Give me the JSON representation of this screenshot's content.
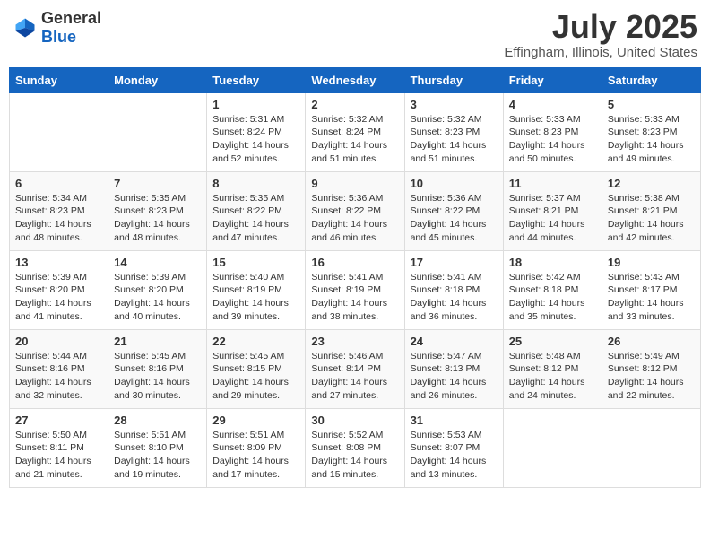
{
  "header": {
    "logo_general": "General",
    "logo_blue": "Blue",
    "month": "July 2025",
    "location": "Effingham, Illinois, United States"
  },
  "weekdays": [
    "Sunday",
    "Monday",
    "Tuesday",
    "Wednesday",
    "Thursday",
    "Friday",
    "Saturday"
  ],
  "weeks": [
    [
      {
        "day": "",
        "info": ""
      },
      {
        "day": "",
        "info": ""
      },
      {
        "day": "1",
        "info": "Sunrise: 5:31 AM\nSunset: 8:24 PM\nDaylight: 14 hours\nand 52 minutes."
      },
      {
        "day": "2",
        "info": "Sunrise: 5:32 AM\nSunset: 8:24 PM\nDaylight: 14 hours\nand 51 minutes."
      },
      {
        "day": "3",
        "info": "Sunrise: 5:32 AM\nSunset: 8:23 PM\nDaylight: 14 hours\nand 51 minutes."
      },
      {
        "day": "4",
        "info": "Sunrise: 5:33 AM\nSunset: 8:23 PM\nDaylight: 14 hours\nand 50 minutes."
      },
      {
        "day": "5",
        "info": "Sunrise: 5:33 AM\nSunset: 8:23 PM\nDaylight: 14 hours\nand 49 minutes."
      }
    ],
    [
      {
        "day": "6",
        "info": "Sunrise: 5:34 AM\nSunset: 8:23 PM\nDaylight: 14 hours\nand 48 minutes."
      },
      {
        "day": "7",
        "info": "Sunrise: 5:35 AM\nSunset: 8:23 PM\nDaylight: 14 hours\nand 48 minutes."
      },
      {
        "day": "8",
        "info": "Sunrise: 5:35 AM\nSunset: 8:22 PM\nDaylight: 14 hours\nand 47 minutes."
      },
      {
        "day": "9",
        "info": "Sunrise: 5:36 AM\nSunset: 8:22 PM\nDaylight: 14 hours\nand 46 minutes."
      },
      {
        "day": "10",
        "info": "Sunrise: 5:36 AM\nSunset: 8:22 PM\nDaylight: 14 hours\nand 45 minutes."
      },
      {
        "day": "11",
        "info": "Sunrise: 5:37 AM\nSunset: 8:21 PM\nDaylight: 14 hours\nand 44 minutes."
      },
      {
        "day": "12",
        "info": "Sunrise: 5:38 AM\nSunset: 8:21 PM\nDaylight: 14 hours\nand 42 minutes."
      }
    ],
    [
      {
        "day": "13",
        "info": "Sunrise: 5:39 AM\nSunset: 8:20 PM\nDaylight: 14 hours\nand 41 minutes."
      },
      {
        "day": "14",
        "info": "Sunrise: 5:39 AM\nSunset: 8:20 PM\nDaylight: 14 hours\nand 40 minutes."
      },
      {
        "day": "15",
        "info": "Sunrise: 5:40 AM\nSunset: 8:19 PM\nDaylight: 14 hours\nand 39 minutes."
      },
      {
        "day": "16",
        "info": "Sunrise: 5:41 AM\nSunset: 8:19 PM\nDaylight: 14 hours\nand 38 minutes."
      },
      {
        "day": "17",
        "info": "Sunrise: 5:41 AM\nSunset: 8:18 PM\nDaylight: 14 hours\nand 36 minutes."
      },
      {
        "day": "18",
        "info": "Sunrise: 5:42 AM\nSunset: 8:18 PM\nDaylight: 14 hours\nand 35 minutes."
      },
      {
        "day": "19",
        "info": "Sunrise: 5:43 AM\nSunset: 8:17 PM\nDaylight: 14 hours\nand 33 minutes."
      }
    ],
    [
      {
        "day": "20",
        "info": "Sunrise: 5:44 AM\nSunset: 8:16 PM\nDaylight: 14 hours\nand 32 minutes."
      },
      {
        "day": "21",
        "info": "Sunrise: 5:45 AM\nSunset: 8:16 PM\nDaylight: 14 hours\nand 30 minutes."
      },
      {
        "day": "22",
        "info": "Sunrise: 5:45 AM\nSunset: 8:15 PM\nDaylight: 14 hours\nand 29 minutes."
      },
      {
        "day": "23",
        "info": "Sunrise: 5:46 AM\nSunset: 8:14 PM\nDaylight: 14 hours\nand 27 minutes."
      },
      {
        "day": "24",
        "info": "Sunrise: 5:47 AM\nSunset: 8:13 PM\nDaylight: 14 hours\nand 26 minutes."
      },
      {
        "day": "25",
        "info": "Sunrise: 5:48 AM\nSunset: 8:12 PM\nDaylight: 14 hours\nand 24 minutes."
      },
      {
        "day": "26",
        "info": "Sunrise: 5:49 AM\nSunset: 8:12 PM\nDaylight: 14 hours\nand 22 minutes."
      }
    ],
    [
      {
        "day": "27",
        "info": "Sunrise: 5:50 AM\nSunset: 8:11 PM\nDaylight: 14 hours\nand 21 minutes."
      },
      {
        "day": "28",
        "info": "Sunrise: 5:51 AM\nSunset: 8:10 PM\nDaylight: 14 hours\nand 19 minutes."
      },
      {
        "day": "29",
        "info": "Sunrise: 5:51 AM\nSunset: 8:09 PM\nDaylight: 14 hours\nand 17 minutes."
      },
      {
        "day": "30",
        "info": "Sunrise: 5:52 AM\nSunset: 8:08 PM\nDaylight: 14 hours\nand 15 minutes."
      },
      {
        "day": "31",
        "info": "Sunrise: 5:53 AM\nSunset: 8:07 PM\nDaylight: 14 hours\nand 13 minutes."
      },
      {
        "day": "",
        "info": ""
      },
      {
        "day": "",
        "info": ""
      }
    ]
  ]
}
